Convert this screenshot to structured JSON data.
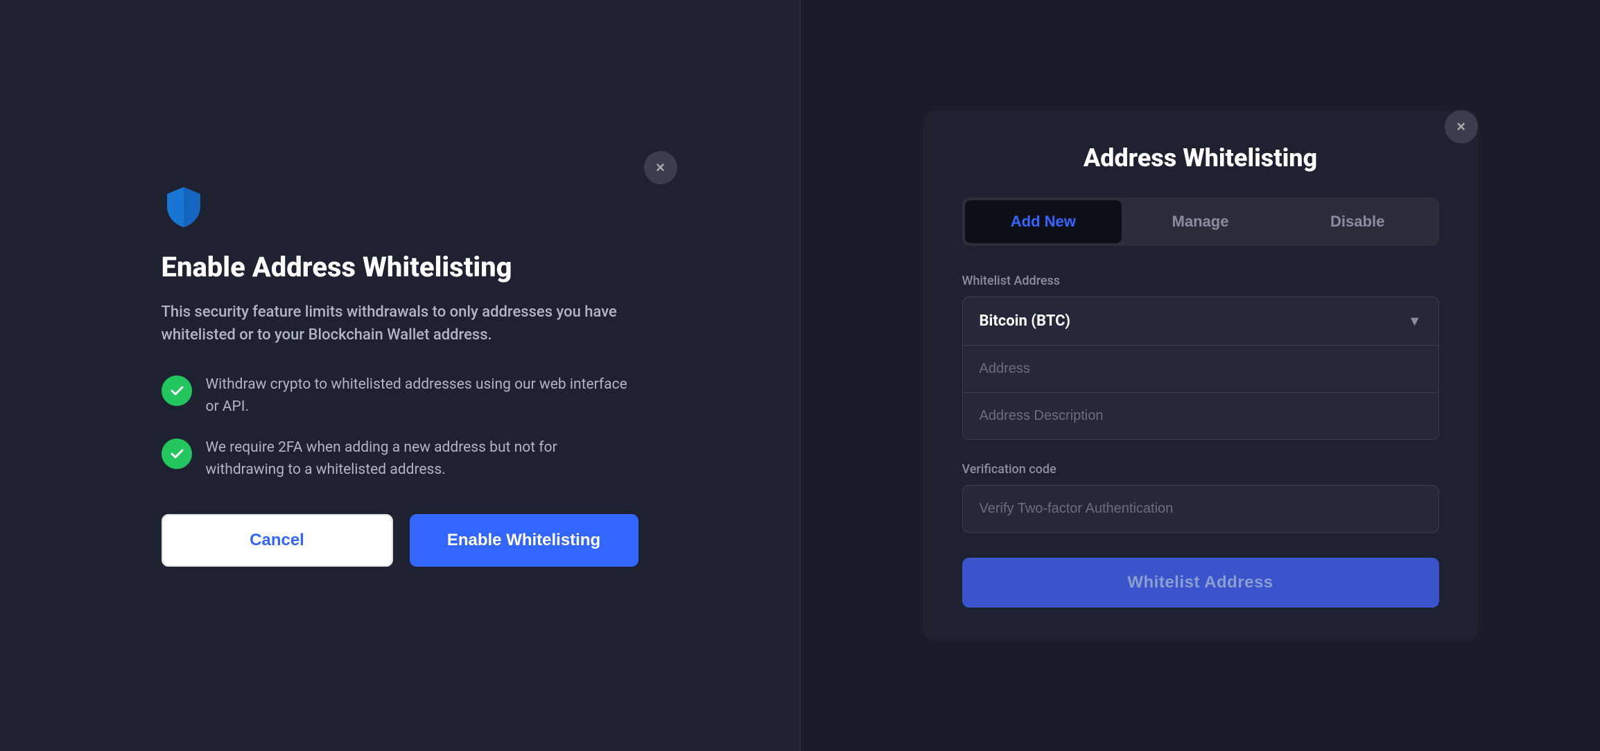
{
  "left": {
    "close_label": "×",
    "title": "Enable Address Whitelisting",
    "description": "This security feature limits withdrawals to only addresses you have whitelisted or to your Blockchain Wallet address.",
    "features": [
      {
        "id": "feature-1",
        "text": "Withdraw crypto to whitelisted addresses using our web interface or API."
      },
      {
        "id": "feature-2",
        "text": "We require 2FA when adding a new address but not for withdrawing to a whitelisted address."
      }
    ],
    "cancel_label": "Cancel",
    "enable_label": "Enable Whitelisting"
  },
  "right": {
    "close_label": "×",
    "title": "Address Whitelisting",
    "tabs": [
      {
        "id": "add-new",
        "label": "Add New",
        "active": true
      },
      {
        "id": "manage",
        "label": "Manage",
        "active": false
      },
      {
        "id": "disable",
        "label": "Disable",
        "active": false
      }
    ],
    "whitelist_address_label": "Whitelist Address",
    "currency_value": "Bitcoin (BTC)",
    "address_placeholder": "Address",
    "address_description_placeholder": "Address Description",
    "verification_label": "Verification code",
    "verify_placeholder": "Verify Two-factor Authentication",
    "submit_label": "Whitelist Address"
  }
}
